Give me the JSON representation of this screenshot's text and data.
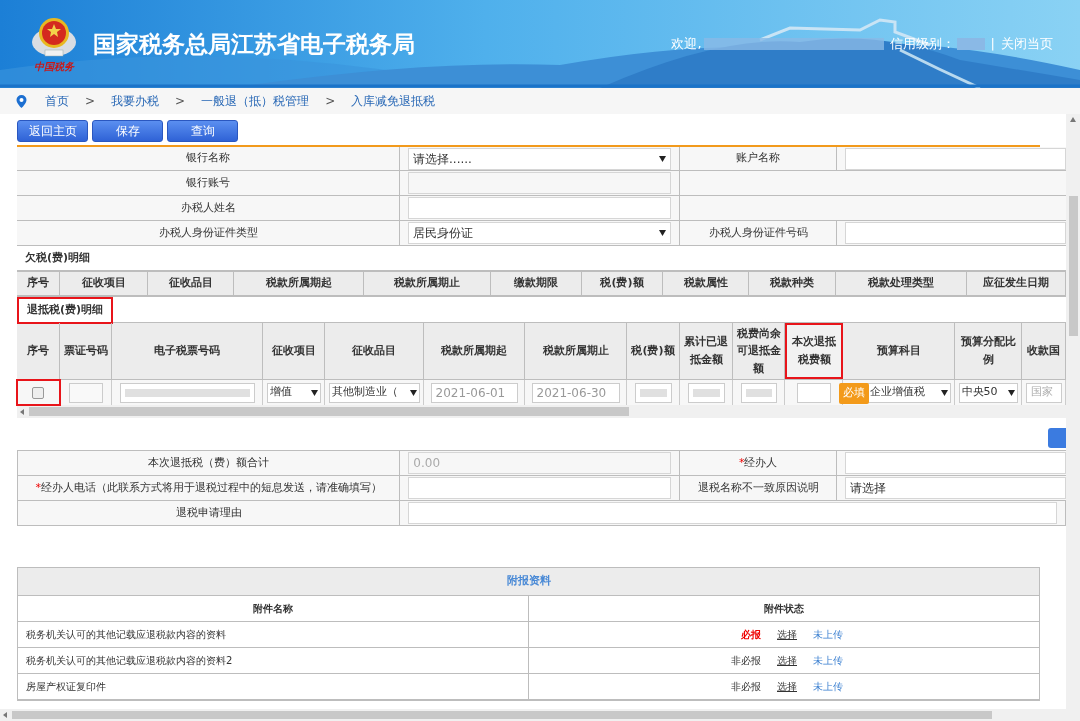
{
  "header": {
    "title": "国家税务总局江苏省电子税务局",
    "logo_caption": "中国税务",
    "welcome": "欢迎,",
    "credit_label": "信用级别：",
    "separator": "|",
    "close": "关闭当页"
  },
  "breadcrumb": [
    "首页",
    "我要办税",
    "一般退（抵）税管理",
    "入库减免退抵税"
  ],
  "breadcrumb_separator": ">",
  "buttons": [
    "返回主页",
    "保存",
    "查询"
  ],
  "bank_form": {
    "rows": [
      {
        "label": "银行名称",
        "field": {
          "kind": "select",
          "value": "请选择......"
        },
        "right_label": "账户名称",
        "right_field": {
          "kind": "input"
        }
      },
      {
        "label": "银行账号",
        "field": {
          "kind": "readonly"
        }
      },
      {
        "label": "办税人姓名",
        "field": {
          "kind": "input"
        }
      },
      {
        "label": "办税人身份证件类型",
        "field": {
          "kind": "select",
          "value": "居民身份证"
        },
        "right_label": "办税人身份证件号码",
        "right_field": {
          "kind": "input"
        }
      }
    ]
  },
  "owed_section": {
    "title": "欠税(费)明细",
    "columns": [
      "序号",
      "征收项目",
      "征收品目",
      "税款所属期起",
      "税款所属期止",
      "缴款期限",
      "税(费)额",
      "税款属性",
      "税款种类",
      "税款处理类型",
      "应征发生日期"
    ]
  },
  "refund_section": {
    "title": "退抵税(费)明细",
    "highlighted": true,
    "columns": [
      {
        "label": "序号",
        "highlighted": false
      },
      {
        "label": "票证号码",
        "highlighted": false
      },
      {
        "label": "电子税票号码",
        "highlighted": false
      },
      {
        "label": "征收项目",
        "highlighted": false
      },
      {
        "label": "征收品目",
        "highlighted": false
      },
      {
        "label": "税款所属期起",
        "highlighted": false
      },
      {
        "label": "税款所属期止",
        "highlighted": false
      },
      {
        "label": "税(费)额",
        "highlighted": false
      },
      {
        "label": "累计已退抵金额",
        "highlighted": false
      },
      {
        "label": "税费尚余可退抵金额",
        "highlighted": false
      },
      {
        "label": "本次退抵税费额",
        "highlighted": true
      },
      {
        "label": "预算科目",
        "highlighted": false
      },
      {
        "label": "预算分配比例",
        "highlighted": false
      },
      {
        "label": "收款国",
        "highlighted": false
      }
    ],
    "row": [
      {
        "kind": "checkbox",
        "checked": false,
        "highlighted": true
      },
      {
        "kind": "input"
      },
      {
        "kind": "redacted"
      },
      {
        "kind": "select",
        "value": "增值"
      },
      {
        "kind": "select",
        "value": "其他制造业（"
      },
      {
        "kind": "date",
        "value": "2021-06-01"
      },
      {
        "kind": "date",
        "value": "2021-06-30"
      },
      {
        "kind": "redacted"
      },
      {
        "kind": "redacted"
      },
      {
        "kind": "redacted"
      },
      {
        "kind": "required",
        "tooltip": "必填"
      },
      {
        "kind": "select",
        "value": "企业增值税"
      },
      {
        "kind": "select",
        "value": "中央50"
      },
      {
        "kind": "placeholder",
        "placeholder": "国家"
      }
    ]
  },
  "summary_form": {
    "rows": [
      {
        "label": "本次退抵税（费）额合计",
        "required": false,
        "field": {
          "kind": "readonly",
          "value": "0.00"
        },
        "right_label": "经办人",
        "right_required": true,
        "right_field": {
          "kind": "input"
        }
      },
      {
        "label": "经办人电话（此联系方式将用于退税过程中的短息发送，请准确填写）",
        "required": true,
        "field": {
          "kind": "input"
        },
        "right_label": "退税名称不一致原因说明",
        "right_required": false,
        "right_field": {
          "kind": "input",
          "value": "请选择"
        }
      },
      {
        "label": "退税申请理由",
        "required": false,
        "field": {
          "kind": "wide"
        }
      }
    ],
    "required_mark": "*"
  },
  "attachments": {
    "title": "附报资料",
    "columns": [
      "附件名称",
      "附件状态"
    ],
    "rows": [
      {
        "name": "税务机关认可的其他记载应退税款内容的资料",
        "requirement": "必报",
        "required": true,
        "action": "选择",
        "status": "未上传"
      },
      {
        "name": "税务机关认可的其他记载应退税款内容的资料2",
        "requirement": "非必报",
        "required": false,
        "action": "选择",
        "status": "未上传"
      },
      {
        "name": "房屋产权证复印件",
        "requirement": "非必报",
        "required": false,
        "action": "选择",
        "status": "未上传"
      }
    ]
  }
}
